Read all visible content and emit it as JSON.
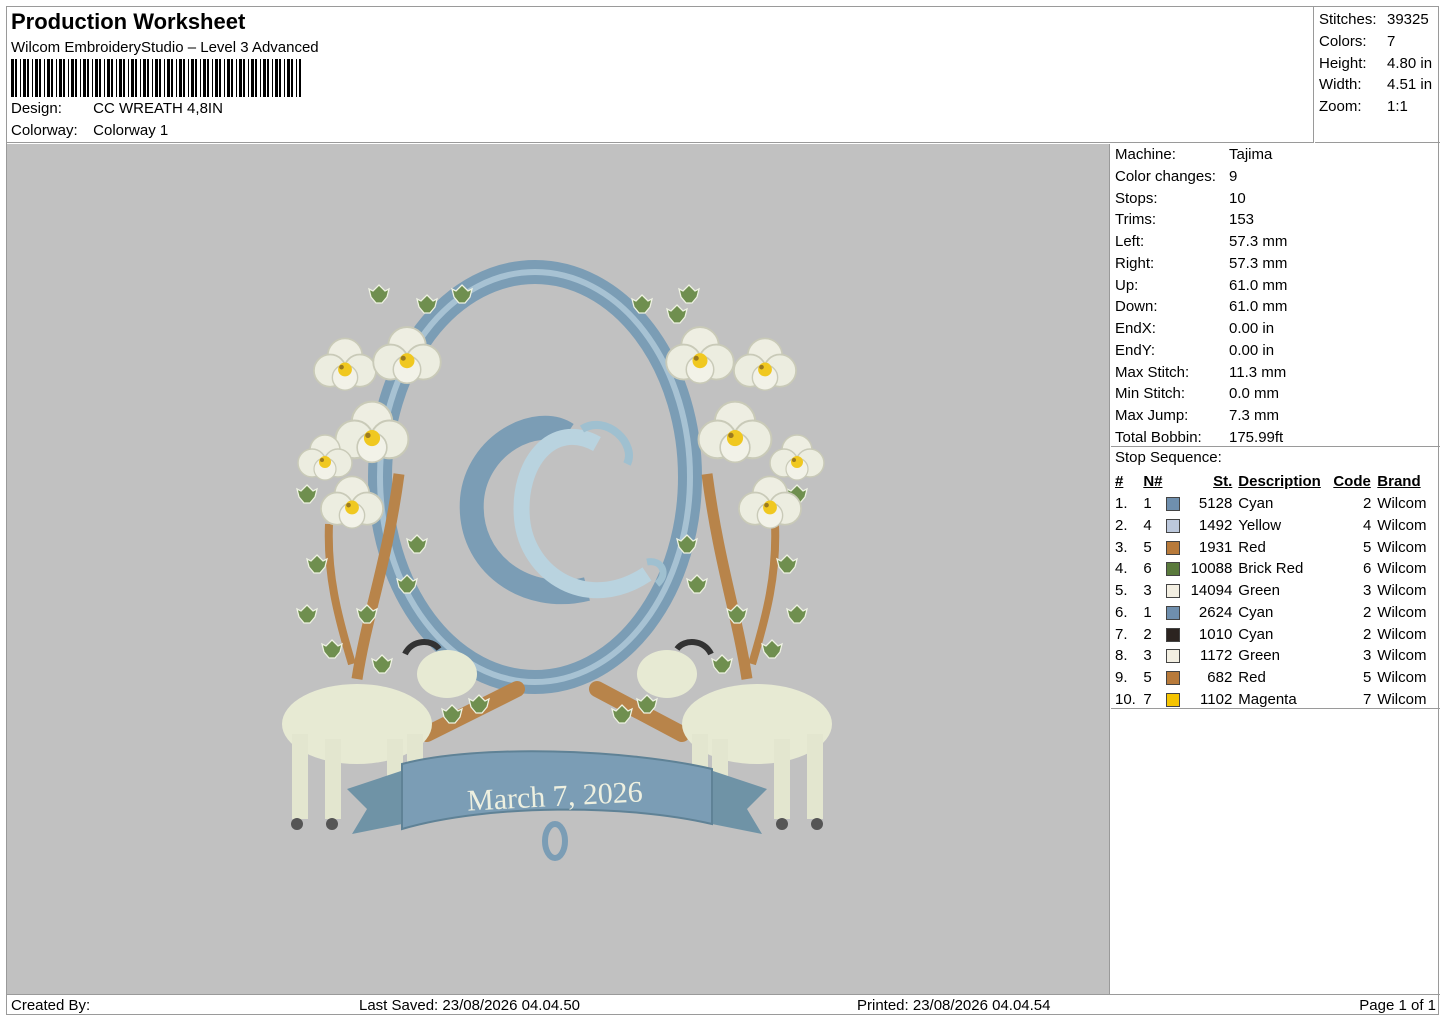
{
  "header": {
    "title": "Production Worksheet",
    "software": "Wilcom EmbroideryStudio – Level 3 Advanced",
    "design_label": "Design:",
    "design_value": "CC WREATH 4,8IN",
    "colorway_label": "Colorway:",
    "colorway_value": "Colorway 1"
  },
  "summary": [
    {
      "label": "Stitches:",
      "value": "39325"
    },
    {
      "label": "Colors:",
      "value": "7"
    },
    {
      "label": "Height:",
      "value": "4.80 in"
    },
    {
      "label": "Width:",
      "value": "4.51 in"
    },
    {
      "label": "Zoom:",
      "value": "1:1"
    }
  ],
  "info": [
    {
      "label": "Machine:",
      "value": "Tajima"
    },
    {
      "label": "Color changes:",
      "value": "9"
    },
    {
      "label": "Stops:",
      "value": "10"
    },
    {
      "label": "Trims:",
      "value": "153"
    },
    {
      "label": "Left:",
      "value": "57.3 mm"
    },
    {
      "label": "Right:",
      "value": "57.3 mm"
    },
    {
      "label": "Up:",
      "value": "61.0 mm"
    },
    {
      "label": "Down:",
      "value": "61.0 mm"
    },
    {
      "label": "EndX:",
      "value": "0.00 in"
    },
    {
      "label": "EndY:",
      "value": "0.00 in"
    },
    {
      "label": "Max Stitch:",
      "value": "11.3 mm"
    },
    {
      "label": "Min Stitch:",
      "value": "0.0 mm"
    },
    {
      "label": "Max Jump:",
      "value": "7.3 mm"
    },
    {
      "label": "Total Bobbin:",
      "value": "175.99ft"
    }
  ],
  "stop_sequence": {
    "caption": "Stop Sequence:",
    "columns": [
      "#",
      "N#",
      "St.",
      "Description",
      "Code",
      "Brand"
    ],
    "rows": [
      {
        "idx": "1.",
        "n": "1",
        "color": "#6f8fae",
        "st": "5128",
        "desc": "Cyan",
        "code": "2",
        "brand": "Wilcom"
      },
      {
        "idx": "2.",
        "n": "4",
        "color": "#bcc8dc",
        "st": "1492",
        "desc": "Yellow",
        "code": "4",
        "brand": "Wilcom"
      },
      {
        "idx": "3.",
        "n": "5",
        "color": "#b87a3a",
        "st": "1931",
        "desc": "Red",
        "code": "5",
        "brand": "Wilcom"
      },
      {
        "idx": "4.",
        "n": "6",
        "color": "#5a7a3c",
        "st": "10088",
        "desc": "Brick Red",
        "code": "6",
        "brand": "Wilcom"
      },
      {
        "idx": "5.",
        "n": "3",
        "color": "#f3efe2",
        "st": "14094",
        "desc": "Green",
        "code": "3",
        "brand": "Wilcom"
      },
      {
        "idx": "6.",
        "n": "1",
        "color": "#6f8fae",
        "st": "2624",
        "desc": "Cyan",
        "code": "2",
        "brand": "Wilcom"
      },
      {
        "idx": "7.",
        "n": "2",
        "color": "#2c2420",
        "st": "1010",
        "desc": "Cyan",
        "code": "2",
        "brand": "Wilcom"
      },
      {
        "idx": "8.",
        "n": "3",
        "color": "#f3efe2",
        "st": "1172",
        "desc": "Green",
        "code": "3",
        "brand": "Wilcom"
      },
      {
        "idx": "9.",
        "n": "5",
        "color": "#b87a3a",
        "st": "682",
        "desc": "Red",
        "code": "5",
        "brand": "Wilcom"
      },
      {
        "idx": "10.",
        "n": "7",
        "color": "#f5c400",
        "st": "1102",
        "desc": "Magenta",
        "code": "7",
        "brand": "Wilcom"
      }
    ]
  },
  "artwork": {
    "banner_text": "March 7, 2026"
  },
  "footer": {
    "created_by": "Created By:",
    "last_saved": "Last Saved: 23/08/2026 04.04.50",
    "printed": "Printed: 23/08/2026 04.04.54",
    "page": "Page 1 of 1"
  }
}
